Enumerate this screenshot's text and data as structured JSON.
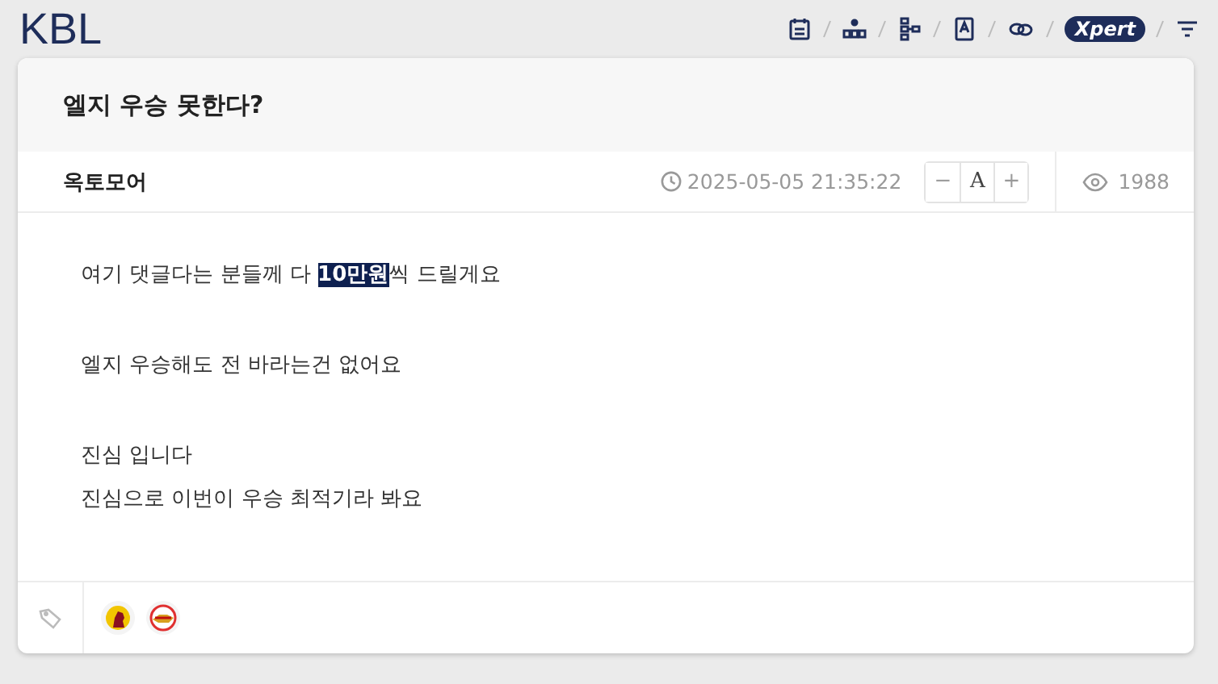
{
  "board": {
    "title": "KBL",
    "toolbar": [
      {
        "kind": "calendar"
      },
      {
        "kind": "org"
      },
      {
        "kind": "tree"
      },
      {
        "kind": "book"
      },
      {
        "kind": "link"
      },
      {
        "kind": "badge",
        "label": "Xpert"
      },
      {
        "kind": "filter"
      }
    ]
  },
  "post": {
    "title": "엘지 우승 못한다?",
    "author": "옥토모어",
    "datetime": "2025-05-05 21:35:22",
    "font_controls": [
      "−",
      "A",
      "+"
    ],
    "views": "1988",
    "paragraphs": [
      [
        "여기 댓글다는 분들께 다 **10만원**씩 드릴게요"
      ],
      [
        "엘지 우승해도 전 바라는건 없어요"
      ],
      [
        "진심 입니다",
        "진심으로 이번이 우승 최적기라 봐요"
      ]
    ],
    "tags": [
      {
        "kind": "team-a"
      },
      {
        "kind": "team-b"
      }
    ]
  }
}
